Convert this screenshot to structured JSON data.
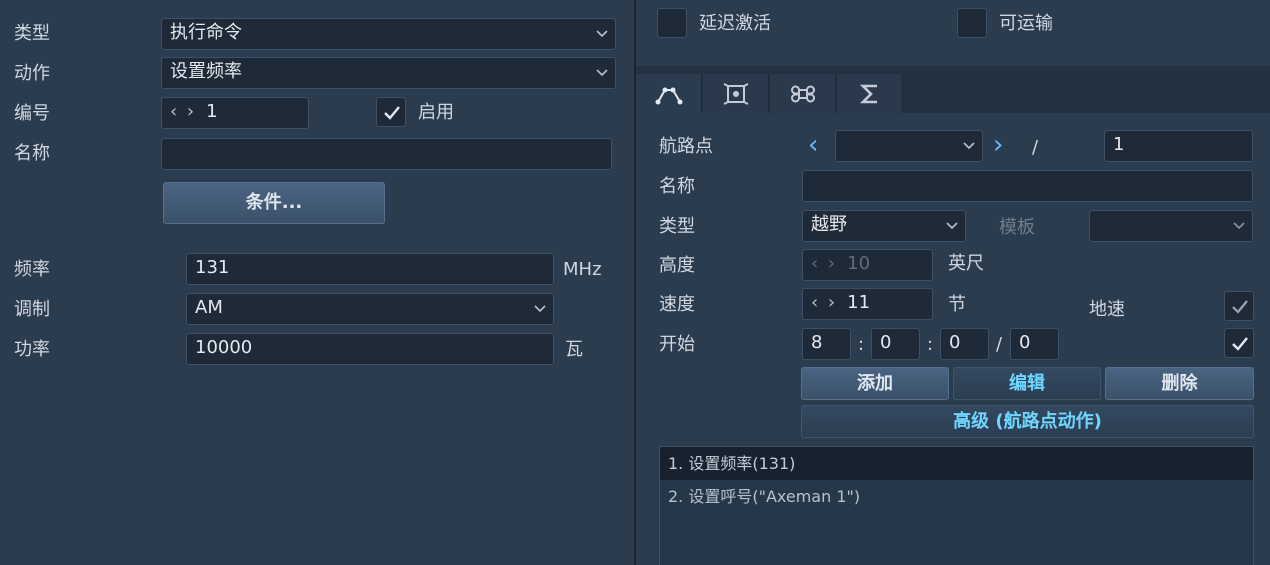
{
  "left": {
    "type_label": "类型",
    "type_value": "执行命令",
    "action_label": "动作",
    "action_value": "设置频率",
    "number_label": "编号",
    "number_value": "1",
    "enable_label": "启用",
    "name_label": "名称",
    "name_value": "",
    "conditions_button": "条件...",
    "frequency_label": "频率",
    "frequency_value": "131",
    "frequency_unit": "MHz",
    "modulation_label": "调制",
    "modulation_value": "AM",
    "power_label": "功率",
    "power_value": "10000",
    "power_unit": "瓦"
  },
  "top_right": {
    "late_activation_label": "延迟激活",
    "transportable_label": "可运输"
  },
  "tabs": [
    {
      "icon": "waypoint-path-icon",
      "active": true
    },
    {
      "icon": "target-frame-icon",
      "active": false
    },
    {
      "icon": "command-key-icon",
      "active": false
    },
    {
      "icon": "sigma-icon",
      "active": false
    }
  ],
  "waypoint": {
    "waypoint_label": "航路点",
    "waypoint_select": "",
    "slash": "/",
    "total": "1",
    "name_label": "名称",
    "name_value": "",
    "type_label": "类型",
    "type_value": "越野",
    "template_label": "模板",
    "template_value": "",
    "altitude_label": "高度",
    "altitude_value": "10",
    "altitude_unit": "英尺",
    "speed_label": "速度",
    "speed_value": "11",
    "speed_unit": "节",
    "ground_speed_label": "地速",
    "start_label": "开始",
    "start_h": "8",
    "start_m": "0",
    "start_s": "0",
    "start_d": "0",
    "colon": ":",
    "add_button": "添加",
    "edit_button": "编辑",
    "delete_button": "删除",
    "advanced_button": "高级 (航路点动作)"
  },
  "actions_list": [
    "1. 设置频率(131)",
    "2. 设置呼号(\"Axeman 1\")"
  ],
  "colors": {
    "background": "#2c3c4f",
    "field": "#1f2a38",
    "accent": "#6fd6ff",
    "arrow": "#6fb7ff"
  }
}
